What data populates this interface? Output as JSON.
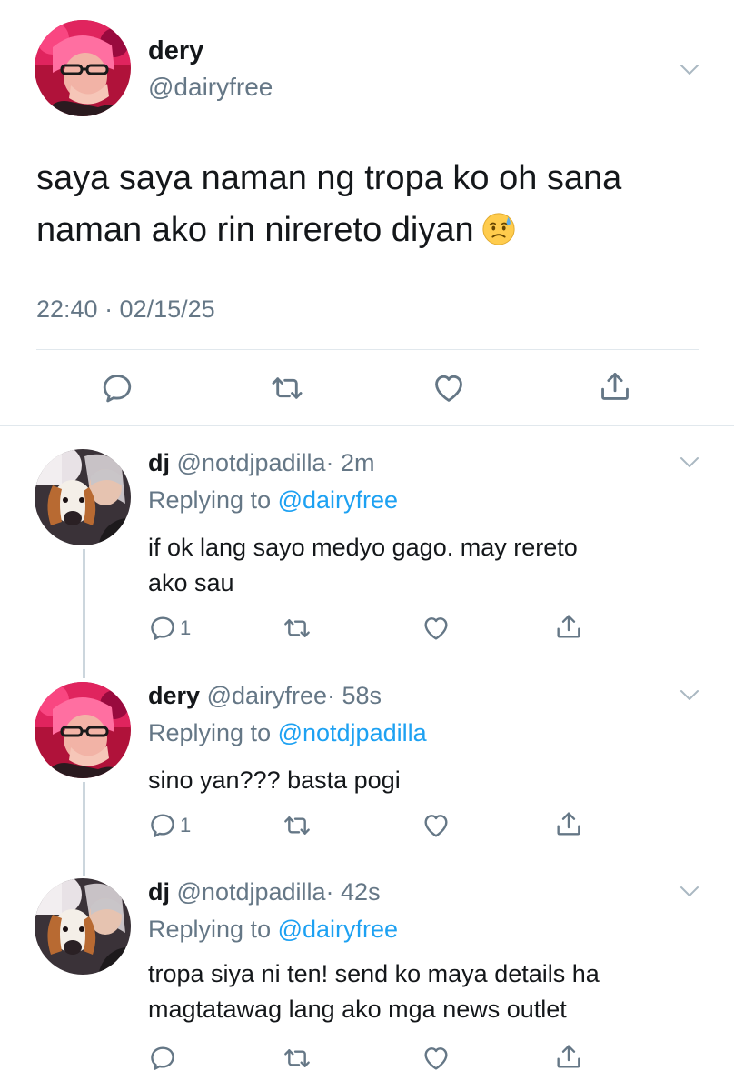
{
  "main_tweet": {
    "name": "dery",
    "handle": "@dairyfree",
    "text": "saya saya naman ng tropa ko oh sana naman ako rin nirereto diyan",
    "emoji": "sad-but-relieved-face",
    "timestamp": "22:40 · 02/15/25",
    "actions": [
      "reply",
      "retweet",
      "like",
      "share"
    ]
  },
  "replies": [
    {
      "name": "dj",
      "handle": "@notdjpadilla",
      "time": "· 2m",
      "replying_prefix": "Replying to ",
      "replying_to": "@dairyfree",
      "text_line1": "if ok lang sayo medyo gago. may rereto",
      "text_line2": "ako sau",
      "reply_count": "1"
    },
    {
      "name": "dery",
      "handle": "@dairyfree",
      "time": "· 58s",
      "replying_prefix": "Replying to ",
      "replying_to": "@notdjpadilla",
      "text_line1": "sino yan??? basta pogi",
      "text_line2": "",
      "reply_count": "1"
    },
    {
      "name": "dj",
      "handle": "@notdjpadilla",
      "time": "· 42s",
      "replying_prefix": "Replying to ",
      "replying_to": "@dairyfree",
      "text_line1": "tropa siya ni ten! send ko maya details ha",
      "text_line2": "magtatawag lang ako mga news outlet",
      "reply_count": ""
    }
  ],
  "colors": {
    "text": "#14171a",
    "secondary": "#657786",
    "link": "#1da1f2",
    "divider": "#e1e8ed"
  }
}
